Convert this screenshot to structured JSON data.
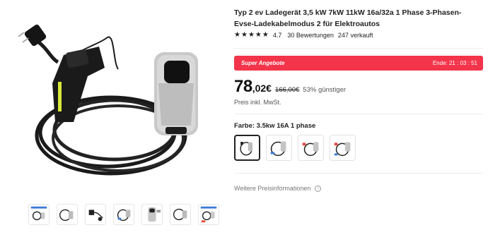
{
  "product": {
    "title": "Typ 2 ev Ladegerät 3,5 kW 7kW 11kW 16a/32a 1 Phase 3-Phasen-Evse-Ladekabelmodus 2 für Elektroautos",
    "rating_value": "4.7",
    "reviews": "30 Bewertungen",
    "sold": "247 verkauft",
    "star_icons": [
      "star-icon",
      "star-icon",
      "star-icon",
      "star-icon",
      "star-icon"
    ]
  },
  "deal": {
    "label": "Super Angebote",
    "ends_text": "Ende: 21 : 03 : 51",
    "color": "#f3344a"
  },
  "price": {
    "main": "78",
    "cents": ",02€",
    "old": "166,00€",
    "discount": "53% günstiger",
    "tax_note": "Preis inkl. MwSt."
  },
  "variant_section": {
    "label": "Farbe: 3.5kw 16A 1 phase",
    "selected_index": 0,
    "count": 4
  },
  "more_info": {
    "label": "Weitere Preisinformationen",
    "icon": "info-icon"
  },
  "gallery": {
    "thumbnail_count": 7,
    "main_image_icon": "ev-charger-cable-image"
  }
}
